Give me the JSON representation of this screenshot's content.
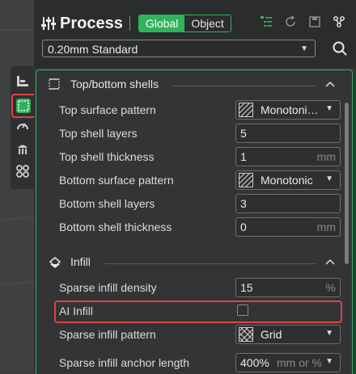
{
  "header": {
    "title": "Process",
    "scope_tabs": [
      {
        "label": "Global",
        "active": true
      },
      {
        "label": "Object",
        "active": false
      }
    ],
    "icons": [
      "settings-tree-icon",
      "reset-icon",
      "save-icon",
      "compare-icon"
    ]
  },
  "preset": {
    "value": "0.20mm Standard"
  },
  "side_tools": [
    "quality-icon",
    "strength-icon",
    "speed-icon",
    "support-icon",
    "others-icon"
  ],
  "sections": {
    "shells": {
      "label": "Top/bottom shells",
      "rows": {
        "top_pattern": {
          "label": "Top surface pattern",
          "value": "Monotoni…",
          "unit": ""
        },
        "top_layers": {
          "label": "Top shell layers",
          "value": "5",
          "unit": ""
        },
        "top_thickness": {
          "label": "Top shell thickness",
          "value": "1",
          "unit": "mm"
        },
        "bottom_pattern": {
          "label": "Bottom surface pattern",
          "value": "Monotonic",
          "unit": ""
        },
        "bottom_layers": {
          "label": "Bottom shell layers",
          "value": "3",
          "unit": ""
        },
        "bottom_thickness": {
          "label": "Bottom shell thickness",
          "value": "0",
          "unit": "mm"
        }
      }
    },
    "infill": {
      "label": "Infill",
      "rows": {
        "density": {
          "label": "Sparse infill density",
          "value": "15",
          "unit": "%"
        },
        "ai_infill": {
          "label": "AI Infill",
          "checked": false
        },
        "pattern": {
          "label": "Sparse infill pattern",
          "value": "Grid",
          "unit": ""
        },
        "anchor": {
          "label": "Sparse infill anchor length",
          "value": "400%",
          "unit": "mm or %"
        }
      }
    }
  },
  "colors": {
    "accent": "#2fb45a",
    "highlight": "#e04343"
  }
}
